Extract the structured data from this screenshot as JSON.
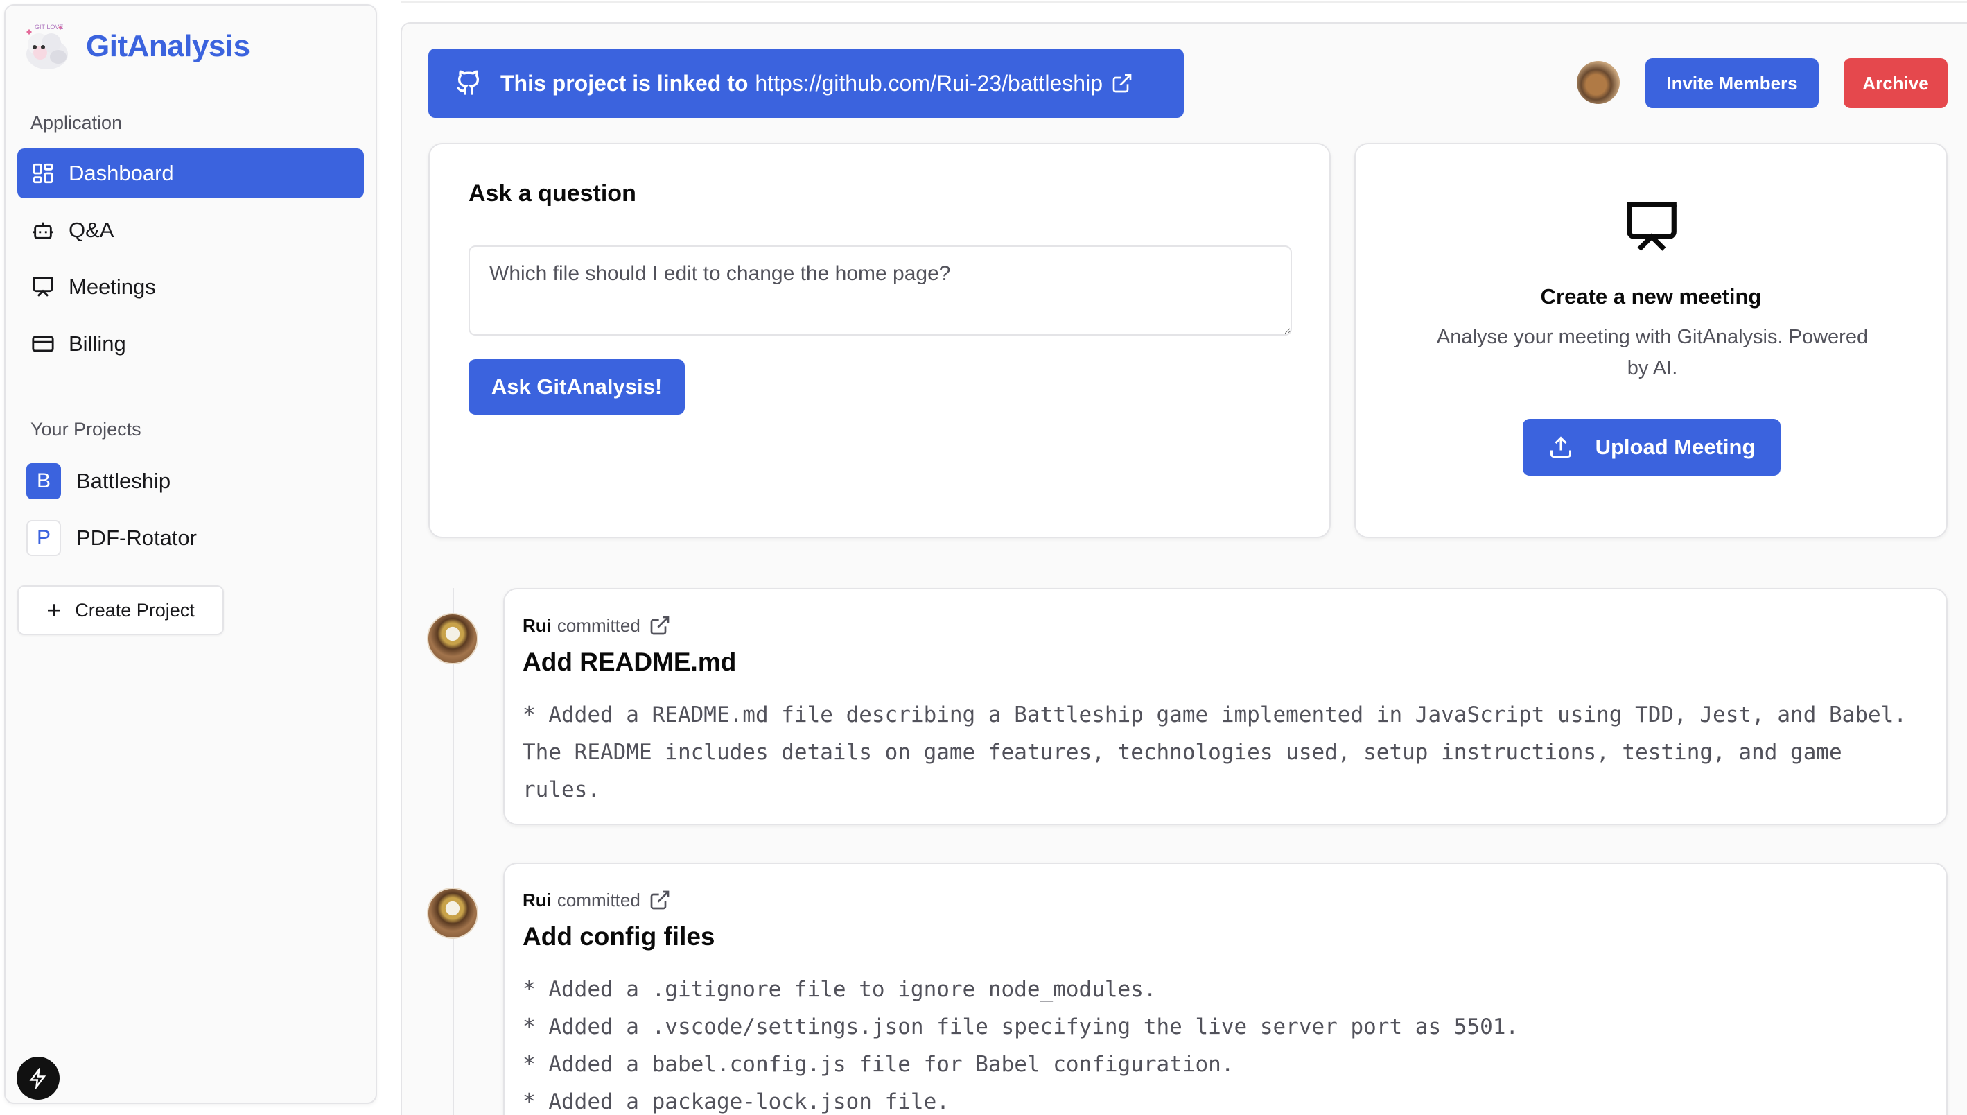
{
  "app": {
    "name": "GitAnalysis"
  },
  "sidebar": {
    "application_label": "Application",
    "nav": [
      {
        "label": "Dashboard",
        "icon": "dashboard-icon",
        "active": true
      },
      {
        "label": "Q&A",
        "icon": "bot-icon",
        "active": false
      },
      {
        "label": "Meetings",
        "icon": "presentation-icon",
        "active": false
      },
      {
        "label": "Billing",
        "icon": "credit-card-icon",
        "active": false
      }
    ],
    "projects_label": "Your Projects",
    "projects": [
      {
        "initial": "B",
        "name": "Battleship",
        "selected": true
      },
      {
        "initial": "P",
        "name": "PDF-Rotator",
        "selected": false
      }
    ],
    "create_project_label": "Create Project"
  },
  "header": {
    "linked_text": "This project is linked to",
    "repo_url": "https://github.com/Rui-23/battleship",
    "invite_label": "Invite Members",
    "archive_label": "Archive"
  },
  "ask": {
    "title": "Ask a question",
    "placeholder": "Which file should I edit to change the home page?",
    "button_label": "Ask GitAnalysis!"
  },
  "meeting": {
    "title": "Create a new meeting",
    "description": "Analyse your meeting with GitAnalysis. Powered by AI.",
    "button_label": "Upload Meeting"
  },
  "commits": [
    {
      "author": "Rui",
      "action": "committed",
      "title": "Add README.md",
      "lines": [
        "* Added a README.md file describing a Battleship game implemented in JavaScript using TDD, Jest, and Babel.",
        "The README includes details on game features, technologies used, setup instructions, testing, and game",
        "rules."
      ]
    },
    {
      "author": "Rui",
      "action": "committed",
      "title": "Add config files",
      "lines": [
        "* Added a .gitignore file to ignore node_modules.",
        "* Added a .vscode/settings.json file specifying the live server port as 5501.",
        "* Added a babel.config.js file for Babel configuration.",
        "* Added a package-lock.json file."
      ]
    }
  ],
  "colors": {
    "primary": "#3b63de",
    "danger": "#e5484d",
    "border": "#e4e4e7",
    "muted_text": "#52525b"
  }
}
